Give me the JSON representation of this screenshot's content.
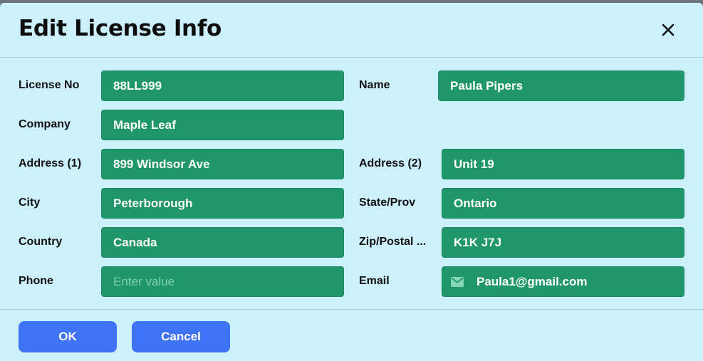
{
  "dialog": {
    "title": "Edit License Info",
    "close_icon": "close-icon"
  },
  "fields": {
    "license_no": {
      "label": "License No",
      "value": "88LL999"
    },
    "name": {
      "label": "Name",
      "value": "Paula Pipers"
    },
    "company": {
      "label": "Company",
      "value": "Maple Leaf"
    },
    "address1": {
      "label": "Address (1)",
      "value": "899 Windsor Ave"
    },
    "address2": {
      "label": "Address (2)",
      "value": "Unit 19"
    },
    "city": {
      "label": "City",
      "value": "Peterborough"
    },
    "state": {
      "label": "State/Prov",
      "value": "Ontario"
    },
    "country": {
      "label": "Country",
      "value": "Canada"
    },
    "zip": {
      "label": "Zip/Postal ...",
      "value": "K1K J7J"
    },
    "phone": {
      "label": "Phone",
      "value": "",
      "placeholder": "Enter value"
    },
    "email": {
      "label": "Email",
      "value": "Paula1@gmail.com",
      "icon": "mail-icon"
    }
  },
  "footer": {
    "ok_label": "OK",
    "cancel_label": "Cancel"
  },
  "colors": {
    "dialog_bg": "#cdf0fd",
    "field_bg": "#20966b",
    "button_bg": "#3f73f5"
  }
}
